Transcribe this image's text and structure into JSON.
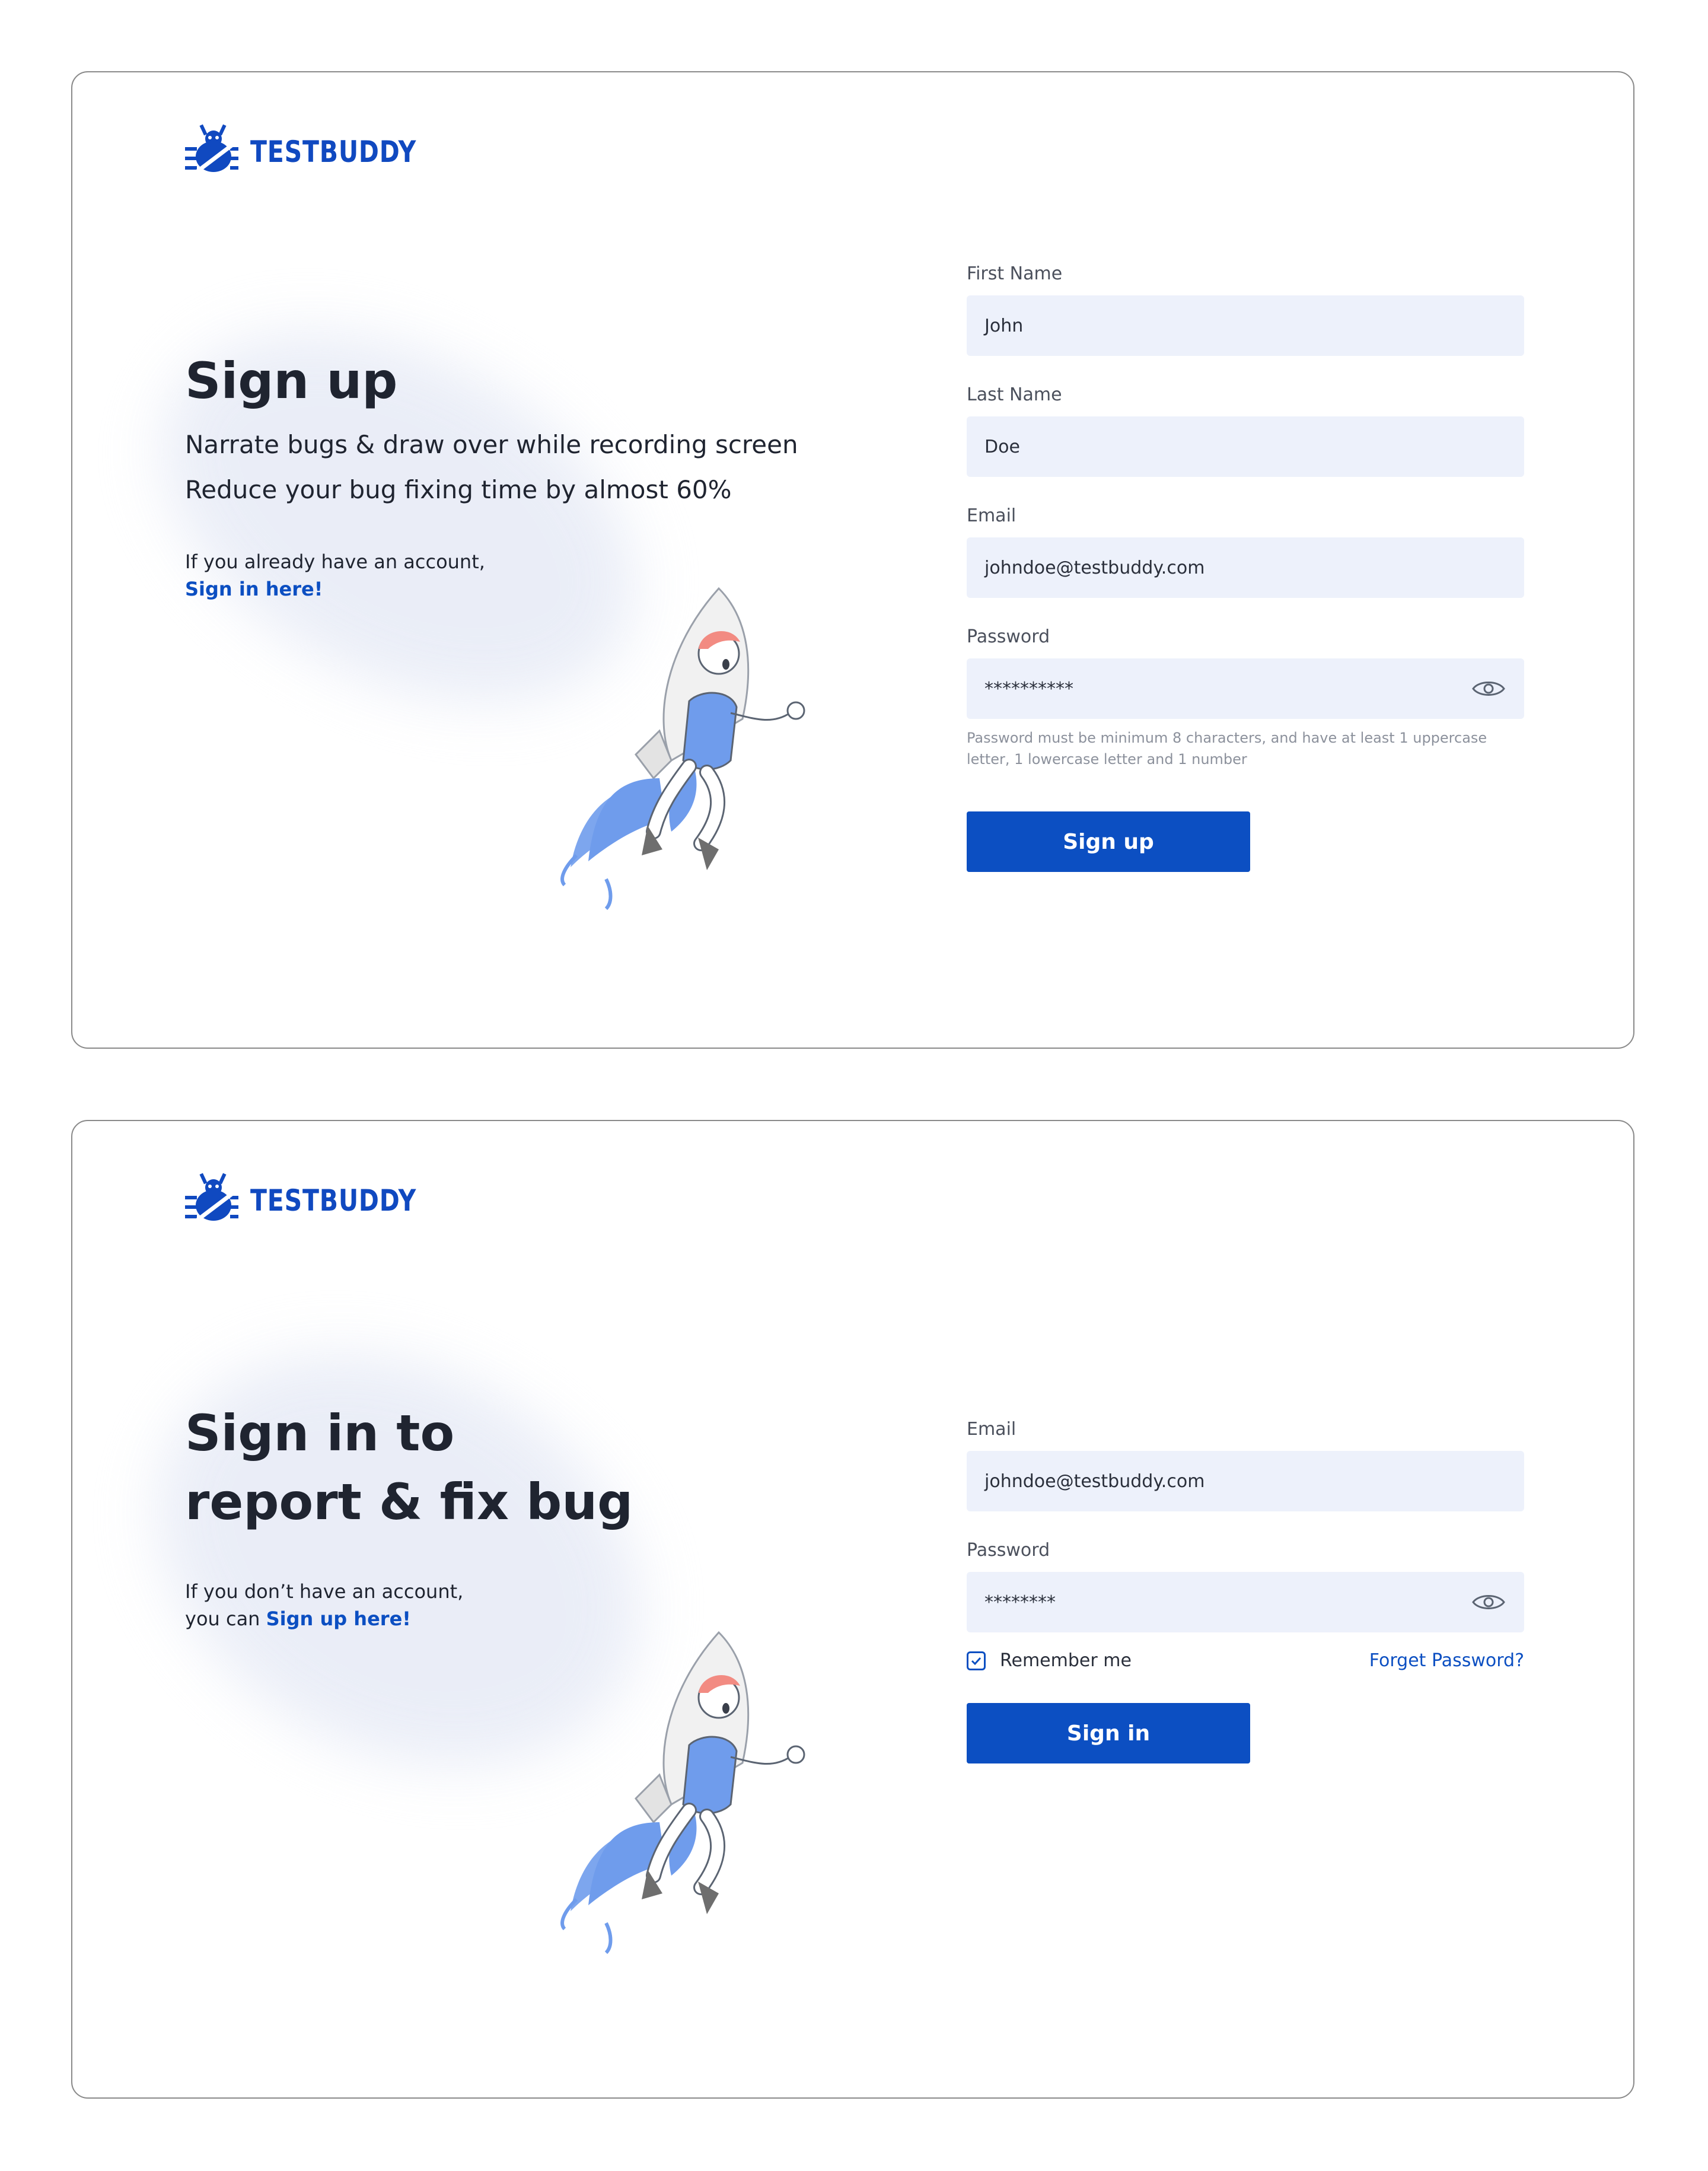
{
  "brand": {
    "name": "TESTBUDDY",
    "color": "#1049c0",
    "logo_icon": "bug-icon"
  },
  "colors": {
    "accent": "#0c4fc2",
    "input_bg": "#edf1fb",
    "heading": "#1f2430"
  },
  "signup": {
    "heading": "Sign up",
    "subtitle_lines": [
      "Narrate bugs & draw over while recording screen",
      "Reduce your bug fixing time by almost 60%"
    ],
    "account_note": "If you already have an account,",
    "signin_link": "Sign in here!",
    "fields": {
      "first_name": {
        "label": "First Name",
        "value": "John"
      },
      "last_name": {
        "label": "Last Name",
        "value": "Doe"
      },
      "email": {
        "label": "Email",
        "value": "johndoe@testbuddy.com"
      },
      "password": {
        "label": "Password",
        "value": "**********",
        "icon": "eye-icon"
      }
    },
    "password_hint": "Password must be minimum 8 characters, and have at least 1 uppercase letter, 1 lowercase letter and 1 number",
    "submit_label": "Sign up"
  },
  "signin": {
    "heading_lines": [
      "Sign in to",
      "report & fix bug"
    ],
    "account_note_line1": "If you don’t have an account,",
    "account_note_prefix": "you can",
    "signup_link": "Sign up here!",
    "fields": {
      "email": {
        "label": "Email",
        "value": "johndoe@testbuddy.com"
      },
      "password": {
        "label": "Password",
        "value": "********",
        "icon": "eye-icon"
      }
    },
    "remember_label": "Remember me",
    "remember_checked": true,
    "forgot_label": "Forget Password?",
    "submit_label": "Sign in"
  }
}
